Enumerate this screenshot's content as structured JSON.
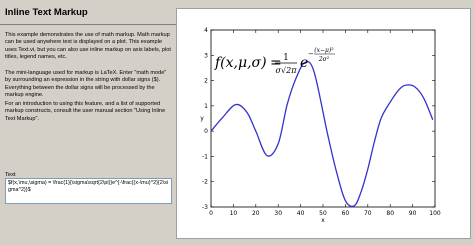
{
  "window": {
    "title": "Inline Text Markup"
  },
  "description": {
    "para1": "This example demonstrates the use of math markup.  Math markup can be used anywhere text is displayed on a plot.  This example uses Text.vi, but you can also use inline markup on axis labels, plot titles, legend names, etc.",
    "para2": "The mini-language used for markup is LaTeX.  Enter \"math mode\" by surrounding an expression in the string with dollar signs ($).  Everything between the dollar signs will be processed by the markup engine.",
    "para3": "For an introduction to using this feature, and a list of supported markup constructs, consult the user manual section \"Using Inline Text Markup\"."
  },
  "text_field": {
    "label": "Text",
    "value": "$f(x,\\mu,\\sigma) = \\frac{1}{\\sigma\\sqrt{2\\pi}}e^{-\\frac{(x-\\mu)^2}{2\\sigma^2}}$"
  },
  "plot": {
    "math_annotation": {
      "lhs": "f(x,μ,σ)",
      "equals": "=",
      "frac_num": "1",
      "frac_den": "σ√2π",
      "base": "e",
      "exp_num": "(x−μ)²",
      "exp_den": "2σ²",
      "exp_sign": "−"
    }
  },
  "chart_data": {
    "type": "line",
    "xlabel": "x",
    "ylabel": "y",
    "xlim": [
      0,
      100
    ],
    "ylim": [
      -3,
      4
    ],
    "xticks": [
      0,
      10,
      20,
      30,
      40,
      50,
      60,
      70,
      80,
      90,
      100
    ],
    "yticks": [
      -3,
      -2,
      -1,
      0,
      1,
      2,
      3,
      4
    ],
    "series": [
      {
        "color": "#3333cc",
        "x": [
          0,
          5,
          11,
          16,
          20,
          25,
          30,
          34,
          38,
          42,
          46,
          52,
          56,
          60,
          64,
          67,
          70,
          73,
          76,
          80,
          84,
          87,
          91,
          95,
          99
        ],
        "y": [
          0.0,
          0.52,
          1.05,
          0.75,
          0.0,
          -0.97,
          -0.5,
          1.05,
          2.1,
          2.72,
          2.35,
          -0.1,
          -1.6,
          -2.75,
          -2.95,
          -2.4,
          -1.5,
          -0.4,
          0.52,
          1.15,
          1.65,
          1.82,
          1.75,
          1.3,
          0.45
        ]
      }
    ]
  }
}
